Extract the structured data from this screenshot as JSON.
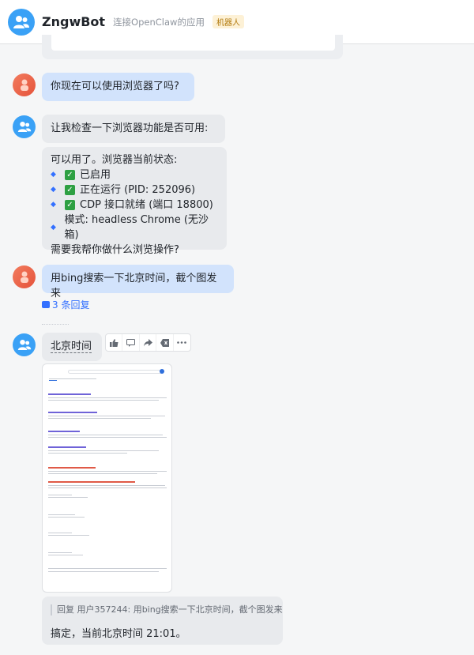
{
  "header": {
    "title": "ZngwBot",
    "subtitle": "连接OpenClaw的应用",
    "tag": "机器人"
  },
  "messages": {
    "q1": "你现在可以使用浏览器了吗?",
    "a1_intro": "让我检查一下浏览器功能是否可用:",
    "a1_status_title": "可以用了。浏览器当前状态:",
    "a1_items": [
      "已启用",
      "正在运行 (PID: 252096)",
      "CDP 接口就绪 (端口 18800)",
      "模式: headless Chrome (无沙箱)"
    ],
    "a1_outro": "需要我帮你做什么浏览操作?",
    "q2": "用bing搜索一下北京时间，截个图发来",
    "q2_replies": "3 条回复",
    "a2_text": "北京时间",
    "a3_quote": "回复 用户357244: 用bing搜索一下北京时间，截个图发来",
    "a3_text": "搞定，当前北京时间 21:01。"
  },
  "icons": {
    "check": "✓",
    "toolbar": [
      "thumb-up-icon",
      "reply-icon",
      "forward-icon",
      "pin-icon",
      "more-icon"
    ]
  },
  "colors": {
    "accent": "#3370ff",
    "user_bubble": "#d2e3fc",
    "bot_bubble": "#e8eaed"
  }
}
